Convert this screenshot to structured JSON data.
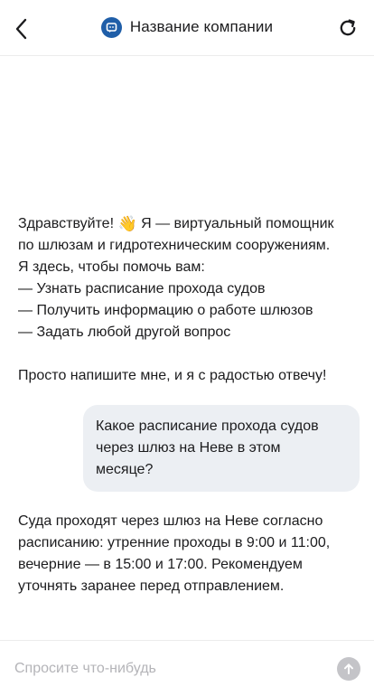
{
  "header": {
    "title": "Название компании",
    "back_icon": "chevron-left-icon",
    "refresh_icon": "refresh-icon",
    "logo_icon": "chat-bot-logo-icon",
    "logo_color": "#1f5ea8"
  },
  "messages": {
    "greeting": {
      "line1_before_emoji": "Здравствуйте! ",
      "emoji": "waving-hand-icon",
      "line1_after_emoji": " Я — виртуальный помощник",
      "line2": "по шлюзам и гидротехническим сооружениям.",
      "line3": "Я здесь, чтобы помочь вам:",
      "item1": "— Узнать расписание прохода судов",
      "item2": "— Получить информацию о работе шлюзов",
      "item3": "— Задать любой другой вопрос",
      "closing": "Просто напишите мне, и я с радостью отвечу!"
    },
    "user_question": {
      "line1": "Какое расписание прохода судов",
      "line2": "через шлюз на Неве в этом",
      "line3": "месяце?"
    },
    "bot_answer": {
      "line1": "Суда проходят через шлюз на Неве согласно",
      "line2": "расписанию: утренние проходы в 9:00 и 11:00,",
      "line3": "вечерние — в 15:00 и 17:00. Рекомендуем",
      "line4": "уточнять заранее перед отправлением."
    }
  },
  "composer": {
    "placeholder": "Спросите что-нибудь",
    "value": "",
    "send_icon": "arrow-up-icon",
    "send_color": "#c4c4c8"
  }
}
